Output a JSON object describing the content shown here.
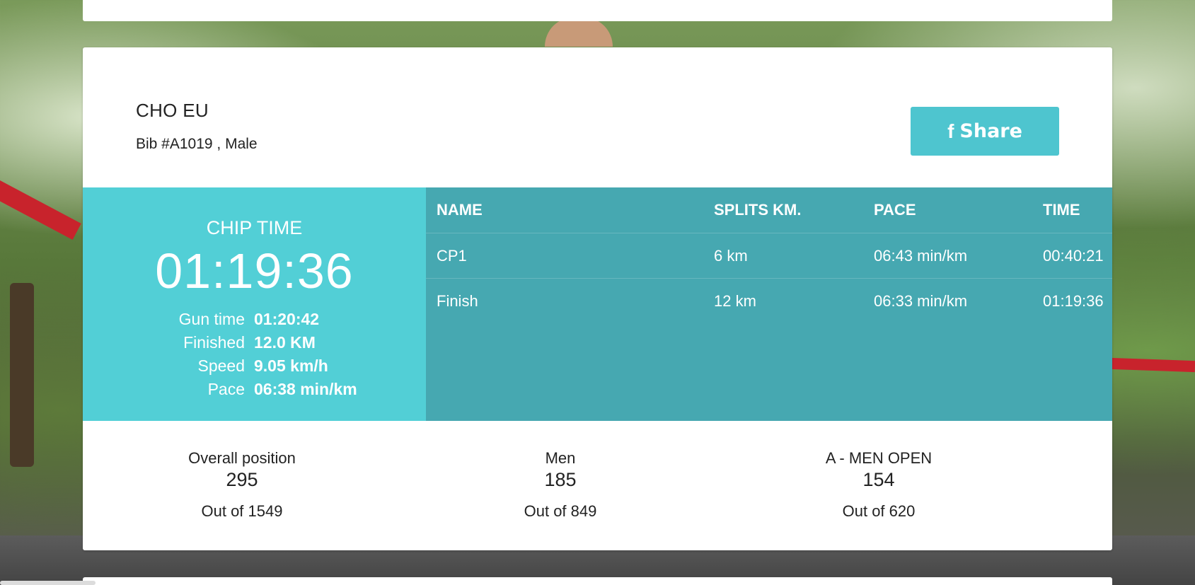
{
  "athlete": {
    "name": "CHO EU",
    "subtitle": "Bib #A1019 , Male"
  },
  "share": {
    "icon": "facebook-icon",
    "label": "Share",
    "color": "#4ec5cf"
  },
  "chip": {
    "label": "CHIP TIME",
    "value": "01:19:36",
    "color": "#52cfd6",
    "stats": [
      {
        "label": "Gun time",
        "value": "01:20:42"
      },
      {
        "label": "Finished",
        "value": "12.0 KM"
      },
      {
        "label": "Speed",
        "value": "9.05 km/h"
      },
      {
        "label": "Pace",
        "value": "06:38 min/km"
      }
    ]
  },
  "splits": {
    "color": "#46a8b1",
    "headers": [
      "NAME",
      "SPLITS KM.",
      "PACE",
      "TIME"
    ],
    "rows": [
      [
        "CP1",
        "6 km",
        "06:43 min/km",
        "00:40:21"
      ],
      [
        "Finish",
        "12 km",
        "06:33 min/km",
        "01:19:36"
      ]
    ]
  },
  "positions": [
    {
      "title": "Overall position",
      "value": "295",
      "out": "Out of 1549"
    },
    {
      "title": "Men",
      "value": "185",
      "out": "Out of 849"
    },
    {
      "title": "A - MEN OPEN",
      "value": "154",
      "out": "Out of 620"
    }
  ]
}
